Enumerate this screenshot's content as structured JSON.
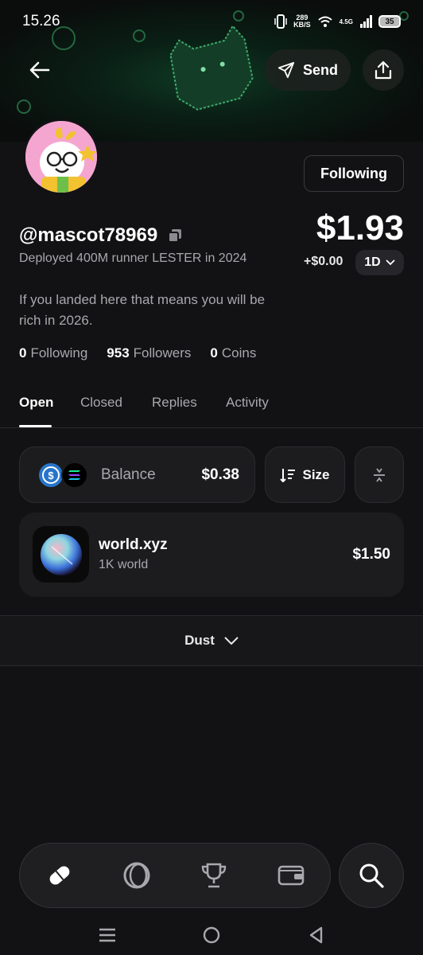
{
  "status_bar": {
    "time": "15.26",
    "network_speed": "289\nKB/S",
    "network_type": "4.5G",
    "battery": "35"
  },
  "header": {
    "back_icon": "arrow-left-icon",
    "send_label": "Send",
    "send_icon": "paper-plane-icon",
    "share_icon": "share-upload-icon"
  },
  "profile": {
    "following_button": "Following",
    "username": "@mascot78969",
    "copy_icon": "copy-icon",
    "subtitle": "Deployed 400M runner LESTER in 2024",
    "bio": "If you landed here that means you will be rich in 2026.",
    "balance": "$1.93",
    "change": "+$0.00",
    "period": "1D",
    "stats": [
      {
        "value": "0",
        "label": "Following"
      },
      {
        "value": "953",
        "label": "Followers"
      },
      {
        "value": "0",
        "label": "Coins"
      }
    ]
  },
  "tabs": [
    {
      "label": "Open",
      "active": true
    },
    {
      "label": "Closed",
      "active": false
    },
    {
      "label": "Replies",
      "active": false
    },
    {
      "label": "Activity",
      "active": false
    }
  ],
  "balance_row": {
    "label": "Balance",
    "value": "$0.38",
    "size_label": "Size"
  },
  "tokens": [
    {
      "name": "world.xyz",
      "subtitle": "1K world",
      "value": "$1.50"
    }
  ],
  "dust_label": "Dust",
  "colors": {
    "background": "#121214",
    "card": "#1c1c1f",
    "muted_text": "#a8a8ad",
    "usdc_blue": "#2775ca",
    "banner_green": "#1f6b40"
  }
}
